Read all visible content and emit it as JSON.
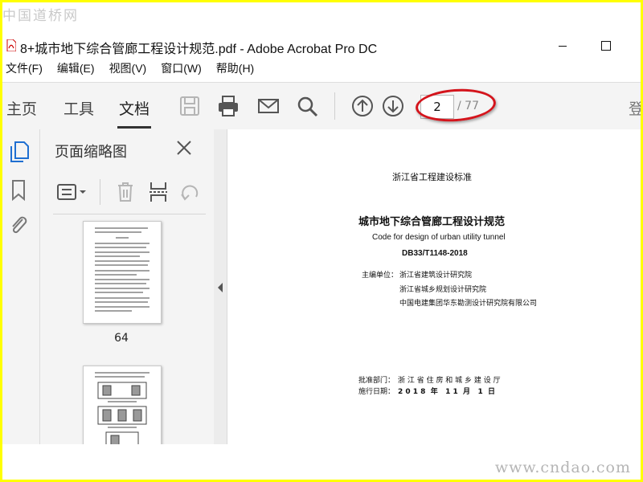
{
  "watermark_top": "中国道桥网",
  "watermark_bottom": "www.cndao.com",
  "window": {
    "title": "8+城市地下综合管廊工程设计规范.pdf - Adobe Acrobat Pro DC"
  },
  "menu": [
    "文件(F)",
    "编辑(E)",
    "视图(V)",
    "窗口(W)",
    "帮助(H)"
  ],
  "toolbar": {
    "tabs": [
      "主页",
      "工具",
      "文档"
    ],
    "active_tab": "文档",
    "current_page": "2",
    "total_pages": "/ 77",
    "sign_in": "登"
  },
  "rail_icons": [
    "page-thumbnails-icon",
    "bookmark-icon",
    "attachment-icon"
  ],
  "panel": {
    "title": "页面缩略图",
    "thumbnails": [
      {
        "label": "64"
      },
      {
        "label": ""
      }
    ]
  },
  "document": {
    "standard_header": "浙江省工程建设标准",
    "title_cn": "城市地下综合管廊工程设计规范",
    "title_en": "Code for design of urban utility tunnel",
    "code": "DB33/T1148-2018",
    "editor_label": "主编单位：",
    "editors": [
      "浙江省建筑设计研究院",
      "浙江省城乡规划设计研究院",
      "中国电建集团华东勘测设计研究院有限公司"
    ],
    "approval_label": "批准部门：",
    "approval_dept": "浙 江 省 住 房 和 城 乡 建 设 厅",
    "date_label": "施行日期：",
    "date_value": "2 0 1 8  年   1 1  月   1  日"
  },
  "colors": {
    "highlight": "#d4141c",
    "chrome": "#f4f4f4",
    "frame": "#ffff00"
  }
}
